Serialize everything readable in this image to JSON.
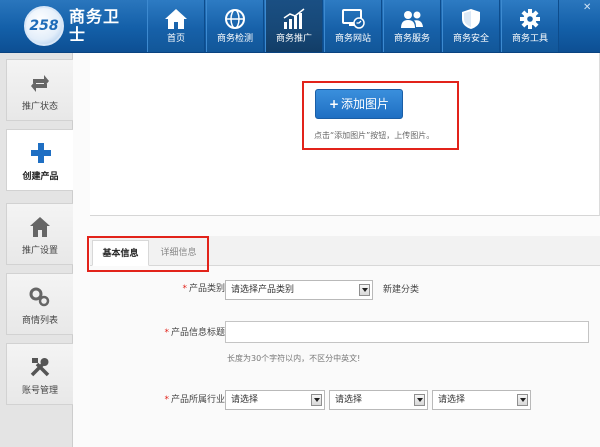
{
  "logo": {
    "badge": "258",
    "name": "商务卫士"
  },
  "nav": [
    {
      "label": "首页",
      "icon": "home-icon"
    },
    {
      "label": "商务检测",
      "icon": "globe-icon"
    },
    {
      "label": "商务推广",
      "icon": "bar-chart-icon",
      "active": true
    },
    {
      "label": "商务网站",
      "icon": "monitor-icon"
    },
    {
      "label": "商务服务",
      "icon": "users-icon"
    },
    {
      "label": "商务安全",
      "icon": "shield-icon"
    },
    {
      "label": "商务工具",
      "icon": "gear-icon"
    }
  ],
  "sidebar": [
    {
      "label": "推广状态",
      "icon": "refresh-arrows-icon"
    },
    {
      "label": "创建产品",
      "icon": "plus-icon",
      "active": true
    },
    {
      "label": "推广设置",
      "icon": "house-icon"
    },
    {
      "label": "商情列表",
      "icon": "gears-icon"
    },
    {
      "label": "账号管理",
      "icon": "tools-icon"
    }
  ],
  "upload": {
    "button_plus": "+",
    "button_label": "添加图片",
    "hint": "点击“添加图片”按钮，上传图片。"
  },
  "tabs": [
    {
      "label": "基本信息",
      "active": true
    },
    {
      "label": "详细信息"
    }
  ],
  "form": {
    "required_mark": "*",
    "category_label": "产品类别:",
    "category_value": "请选择产品类别",
    "new_category": "新建分类",
    "title_label": "产品信息标题:",
    "title_value": "",
    "title_hint": "长度为30个字符以内，不区分中英文!",
    "industry_label": "产品所属行业:",
    "industry_selects": [
      "请选择",
      "请选择",
      "请选择"
    ]
  },
  "colors": {
    "top_bar": "#135fa8",
    "active_nav": "#174877",
    "button": "#1f6fc3",
    "highlight_box": "#e2231a",
    "required": "#e2231a"
  }
}
